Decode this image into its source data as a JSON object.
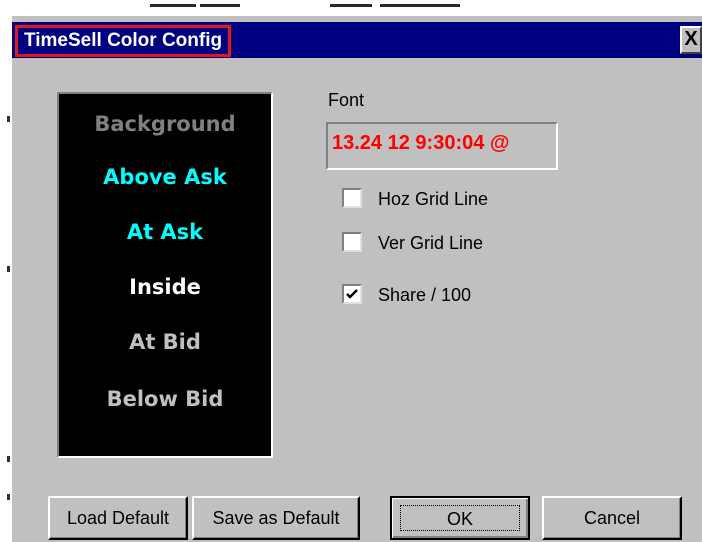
{
  "window": {
    "title": "TimeSell Color Config",
    "close_glyph": "X"
  },
  "color_list": {
    "items": [
      {
        "label": "Background",
        "color": "#808080"
      },
      {
        "label": "Above Ask",
        "color": "#00ffff"
      },
      {
        "label": "At Ask",
        "color": "#00ffff"
      },
      {
        "label": "Inside",
        "color": "#ffffff"
      },
      {
        "label": "At Bid",
        "color": "#c0c0c0"
      },
      {
        "label": "Below Bid",
        "color": "#c0c0c0"
      }
    ],
    "background_color": "#000000"
  },
  "font": {
    "label": "Font",
    "sample": "13.24  12 9:30:04  @",
    "sample_color": "#ff0000"
  },
  "options": [
    {
      "label": "Hoz Grid Line",
      "checked": false
    },
    {
      "label": "Ver Grid Line",
      "checked": false
    },
    {
      "label": "Share / 100",
      "checked": true
    }
  ],
  "buttons": {
    "load_default": "Load Default",
    "save_default": "Save as Default",
    "ok": "OK",
    "cancel": "Cancel"
  },
  "colors": {
    "titlebar": "#000080",
    "dialog": "#c0c0c0",
    "highlight": "#e01818"
  }
}
